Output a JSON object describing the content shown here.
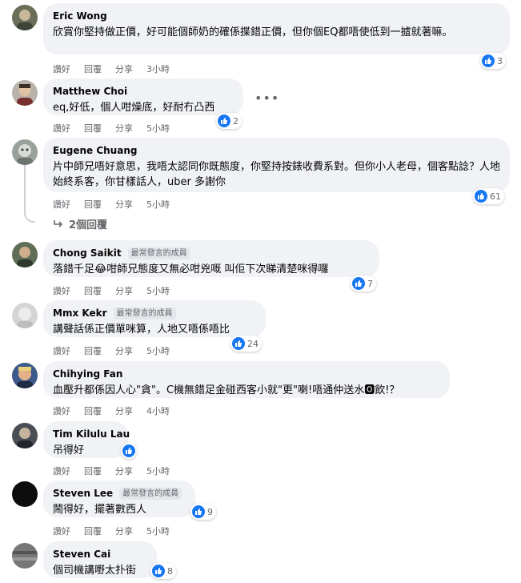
{
  "actions": {
    "like": "讚好",
    "reply": "回覆",
    "share": "分享"
  },
  "badge_label": "最常發言的成員",
  "replies_link": "2個回覆",
  "comments": [
    {
      "name": "Eric Wong",
      "text": "欣賞你堅持做正價，好可能個師奶的確係揲錯正價，但你個EQ都唔使低到一摣就著嘛。",
      "time": "3小時",
      "likes": "3"
    },
    {
      "name": "Matthew Choi",
      "text": "eq,好低，個人咁燥底，好耐冇凸西",
      "time": "5小時",
      "likes": "2"
    },
    {
      "name": "Eugene Chuang",
      "text": "片中師兄唔好意思，我唔太認同你既態度，你堅持按錶收費系對。但你小人老母，個客點諗？人地始終系客，你甘樣話人，uber 多謝你",
      "time": "5小時",
      "likes": "61"
    },
    {
      "name": "Chong Saikit",
      "text": "落錯千足😂咁師兄態度又無必咁兇嘅 叫佢下次睇清楚咪得囉",
      "time": "5小時",
      "likes": "7"
    },
    {
      "name": "Mmx Kekr",
      "text": "講聲話係正價單咪算，人地又唔係唔比",
      "time": "5小時",
      "likes": "24"
    },
    {
      "name": "Chihying Fan",
      "text": "血壓升都係因人心\"貪\"。C機無錯足金碰西客小就\"更\"喇!唔通仲送水🅾飲!？",
      "time": "4小時",
      "likes": ""
    },
    {
      "name": "Tim Kilulu Lau",
      "text": "吊得好",
      "time": "5小時",
      "likes": ""
    },
    {
      "name": "Steven Lee",
      "text": "鬧得好，擺著數西人",
      "time": "5小時",
      "likes": "9"
    },
    {
      "name": "Steven Cai",
      "text": "個司機講嘢太扑街",
      "time": "",
      "likes": "8"
    }
  ],
  "colors": {
    "like_blue": "#1877f2",
    "bubble_bg": "#f0f2f5",
    "meta_grey": "#65676b"
  }
}
